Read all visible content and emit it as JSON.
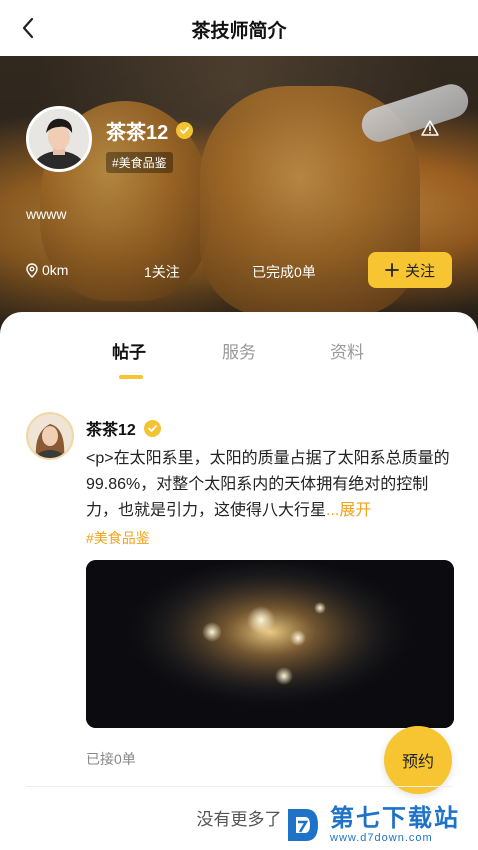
{
  "header": {
    "title": "茶技师简介",
    "back_icon": "chevron-left-icon"
  },
  "profile": {
    "name": "茶茶12",
    "tag": "#美食品鉴",
    "bio": "wwww",
    "distance": "0km",
    "following": "1关注",
    "completed": "已完成0单",
    "follow_button": "关注",
    "verified_icon": "verified-badge-icon",
    "report_icon": "warning-icon"
  },
  "tabs": [
    {
      "label": "帖子",
      "active": true
    },
    {
      "label": "服务",
      "active": false
    },
    {
      "label": "资料",
      "active": false
    }
  ],
  "post": {
    "author": "茶茶12",
    "text": "<p>在太阳系里，太阳的质量占据了太阳系总质量的 99.86%，对整个太阳系内的天体拥有绝对的控制力，也就是引力，这使得八大行星",
    "expand_label": "...展开",
    "tag": "#美食品鉴",
    "accepted": "已接0单"
  },
  "book_button": "预约",
  "footer": {
    "no_more": "没有更多了"
  },
  "watermark": {
    "name": "第七下载站",
    "url": "www.d7down.com"
  },
  "colors": {
    "accent": "#f6c531",
    "link": "#f0a31e",
    "watermark": "#1e73c8"
  }
}
